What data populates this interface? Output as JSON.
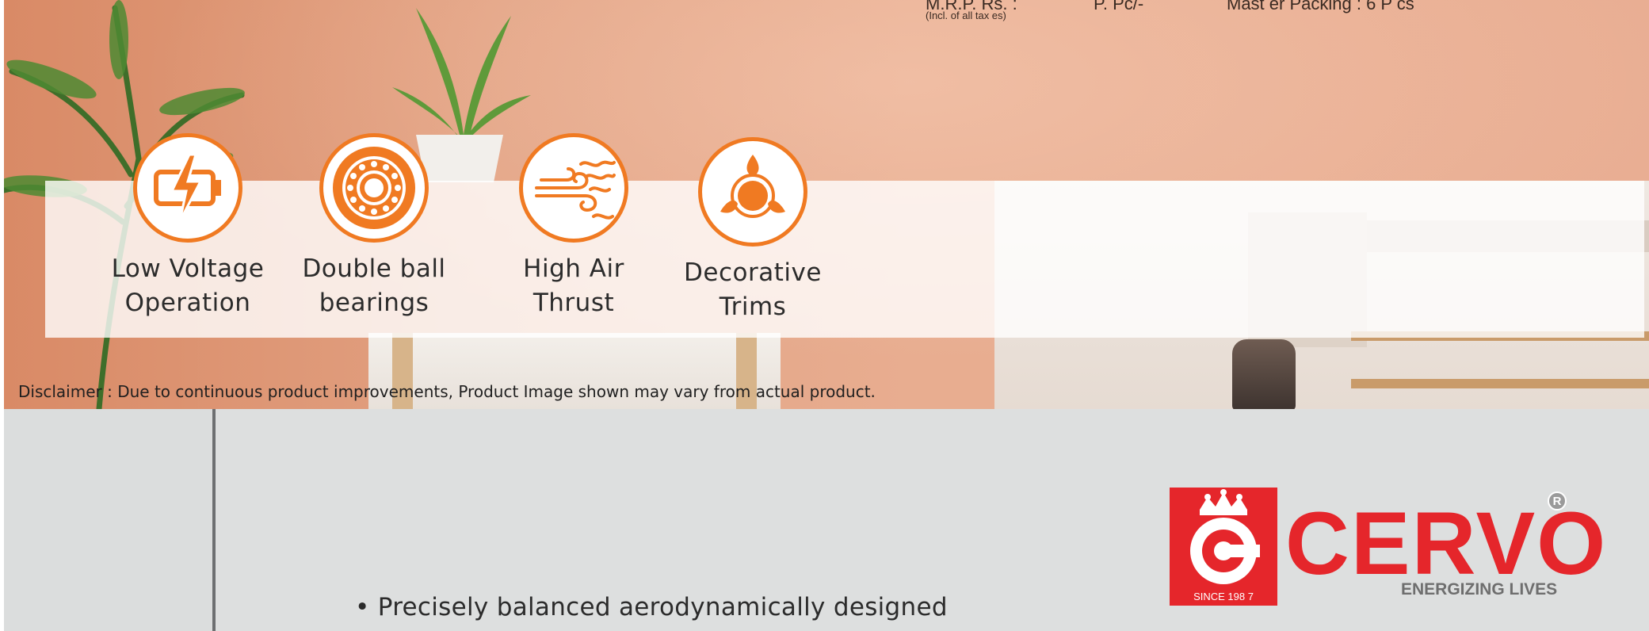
{
  "header": {
    "mrp_label": "M.R.P. Rs. :",
    "mrp_note": "(Incl. of all tax  es)",
    "price_unit": "P. Pc/-",
    "master_packing": "Mast er Packing : 6 P   cs"
  },
  "features": [
    {
      "icon": "battery-bolt-icon",
      "line1": "Low Voltage",
      "line2": "Operation"
    },
    {
      "icon": "ball-bearing-icon",
      "line1": "Double ball",
      "line2": "bearings"
    },
    {
      "icon": "air-wind-icon",
      "line1": "High Air",
      "line2": "Thrust"
    },
    {
      "icon": "decorative-trim-icon",
      "line1": "Decorative",
      "line2": "Trims"
    }
  ],
  "disclaimer": "Disclaimer : Due to continuous product improvements, Product Image shown may vary from actual product.",
  "bullet": "• Precisely balanced aerodynamically designed",
  "brand": {
    "name": "CERVO",
    "tagline": "ENERGIZING LIVES",
    "since": "SINCE 198 7",
    "registered": "R"
  },
  "colors": {
    "accent_orange": "#f07a22",
    "brand_red": "#e5262b",
    "wall": "#e8ad90",
    "tagline_gray": "#6e6e6e"
  }
}
